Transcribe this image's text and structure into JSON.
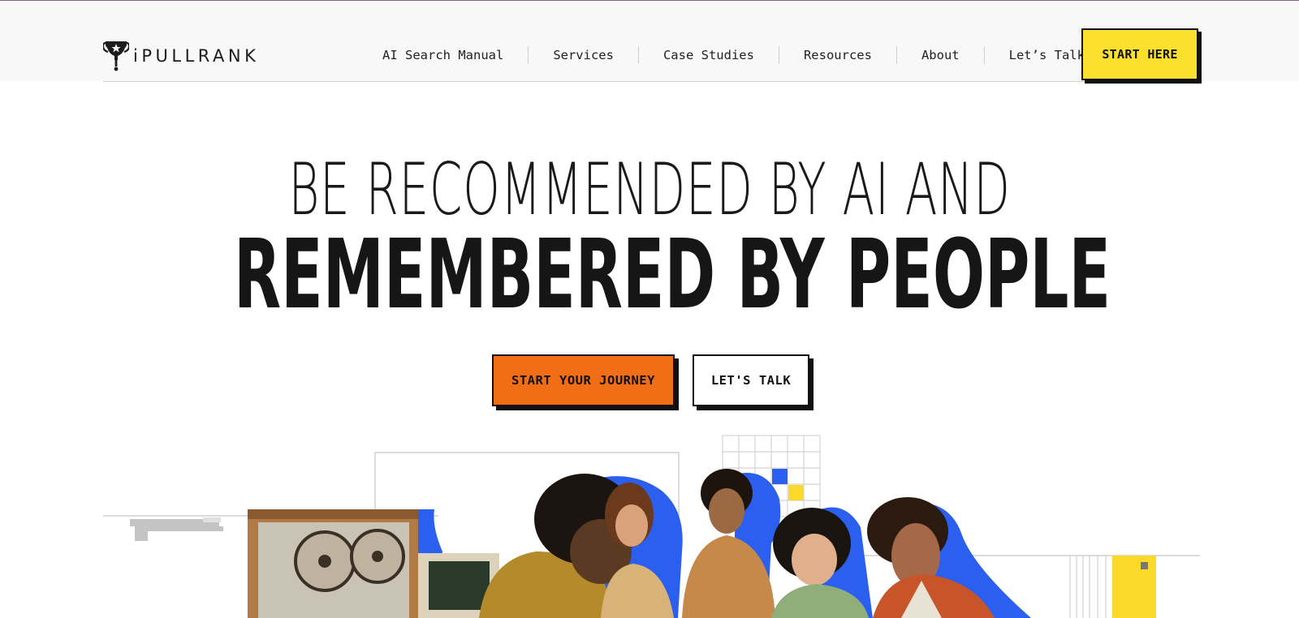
{
  "brand": {
    "name": "iPULLRANK"
  },
  "nav": {
    "items": [
      {
        "label": "AI Search Manual"
      },
      {
        "label": "Services"
      },
      {
        "label": "Case Studies"
      },
      {
        "label": "Resources"
      },
      {
        "label": "About"
      },
      {
        "label": "Let’s Talk"
      }
    ],
    "cta_label": "START HERE"
  },
  "hero": {
    "line1": "BE RECOMMENDED BY AI AND",
    "line2": "REMEMBERED BY PEOPLE",
    "primary_cta": "START YOUR JOURNEY",
    "secondary_cta": "LET'S TALK"
  },
  "colors": {
    "accent_yellow": "#fbe02d",
    "accent_orange": "#f26e16",
    "accent_blue": "#2b5ff0",
    "text_dark": "#161616"
  },
  "icons": {
    "logo": "trophy-icon"
  }
}
